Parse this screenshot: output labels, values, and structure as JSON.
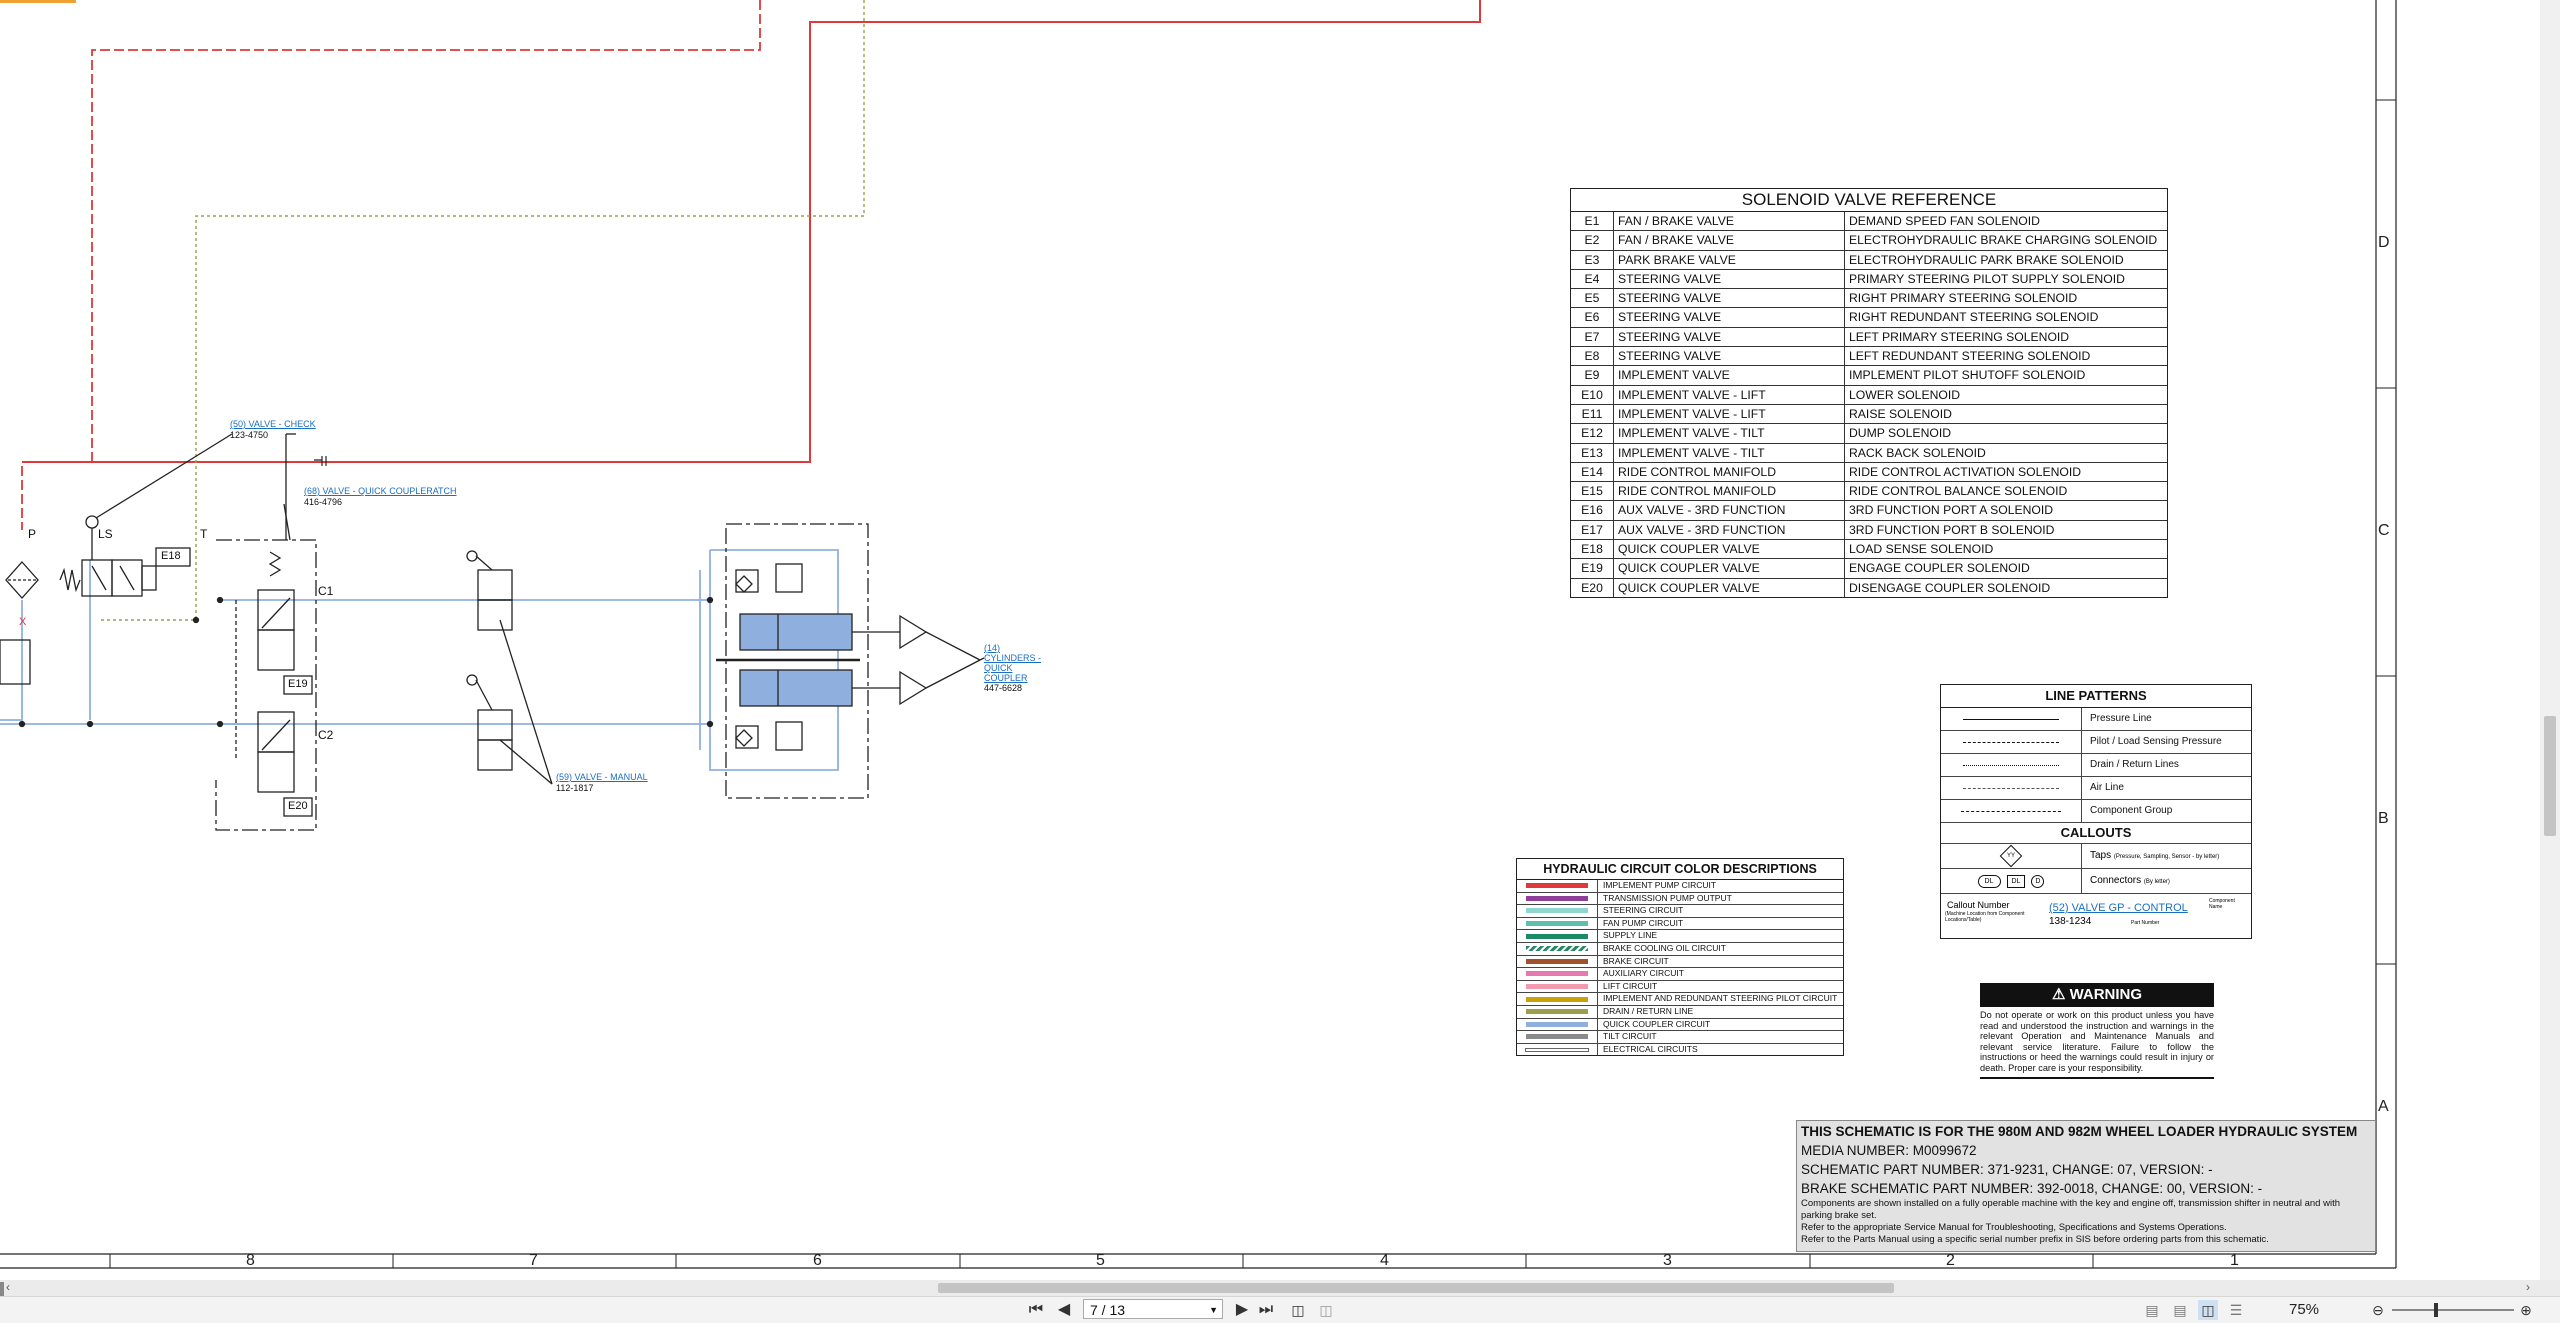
{
  "callouts": {
    "check_valve": {
      "name": "(50) VALVE - CHECK",
      "part": "123-4750"
    },
    "coupler_latch": {
      "name": "(68) VALVE - QUICK COUPLERATCH",
      "part": "416-4796"
    },
    "manual_valve": {
      "name": "(59) VALVE - MANUAL",
      "part": "112-1817"
    },
    "cylinders": {
      "name": "(14) CYLINDERS - QUICK COUPLER",
      "part": "447-6628"
    }
  },
  "schematic_labels": {
    "P": "P",
    "LS": "LS",
    "T": "T",
    "X": "X",
    "C1": "C1",
    "C2": "C2",
    "E18": "E18",
    "E19": "E19",
    "E20": "E20"
  },
  "solenoid": {
    "title": "SOLENOID VALVE REFERENCE",
    "rows": [
      [
        "E1",
        "FAN / BRAKE VALVE",
        "DEMAND SPEED FAN SOLENOID"
      ],
      [
        "E2",
        "FAN / BRAKE VALVE",
        "ELECTROHYDRAULIC BRAKE CHARGING SOLENOID"
      ],
      [
        "E3",
        "PARK BRAKE VALVE",
        "ELECTROHYDRAULIC PARK BRAKE SOLENOID"
      ],
      [
        "E4",
        "STEERING VALVE",
        "PRIMARY STEERING PILOT SUPPLY SOLENOID"
      ],
      [
        "E5",
        "STEERING VALVE",
        "RIGHT PRIMARY STEERING SOLENOID"
      ],
      [
        "E6",
        "STEERING VALVE",
        "RIGHT REDUNDANT STEERING SOLENOID"
      ],
      [
        "E7",
        "STEERING VALVE",
        "LEFT PRIMARY STEERING SOLENOID"
      ],
      [
        "E8",
        "STEERING VALVE",
        "LEFT REDUNDANT STEERING SOLENOID"
      ],
      [
        "E9",
        "IMPLEMENT VALVE",
        "IMPLEMENT PILOT SHUTOFF SOLENOID"
      ],
      [
        "E10",
        "IMPLEMENT VALVE - LIFT",
        "LOWER SOLENOID"
      ],
      [
        "E11",
        "IMPLEMENT VALVE - LIFT",
        "RAISE SOLENOID"
      ],
      [
        "E12",
        "IMPLEMENT VALVE - TILT",
        "DUMP SOLENOID"
      ],
      [
        "E13",
        "IMPLEMENT VALVE - TILT",
        "RACK BACK SOLENOID"
      ],
      [
        "E14",
        "RIDE CONTROL MANIFOLD",
        "RIDE CONTROL ACTIVATION SOLENOID"
      ],
      [
        "E15",
        "RIDE CONTROL MANIFOLD",
        "RIDE CONTROL BALANCE SOLENOID"
      ],
      [
        "E16",
        "AUX VALVE - 3RD FUNCTION",
        "3RD FUNCTION PORT A SOLENOID"
      ],
      [
        "E17",
        "AUX VALVE - 3RD FUNCTION",
        "3RD FUNCTION PORT B SOLENOID"
      ],
      [
        "E18",
        "QUICK COUPLER VALVE",
        "LOAD SENSE SOLENOID"
      ],
      [
        "E19",
        "QUICK COUPLER VALVE",
        "ENGAGE COUPLER SOLENOID"
      ],
      [
        "E20",
        "QUICK COUPLER VALVE",
        "DISENGAGE COUPLER SOLENOID"
      ]
    ]
  },
  "colors": {
    "title": "HYDRAULIC CIRCUIT COLOR DESCRIPTIONS",
    "rows": [
      {
        "label": "IMPLEMENT PUMP CIRCUIT",
        "color": "#e0393b"
      },
      {
        "label": "TRANSMISSION PUMP OUTPUT",
        "color": "#8e3f9a"
      },
      {
        "label": "STEERING CIRCUIT",
        "color": "#8fd6d0"
      },
      {
        "label": "FAN PUMP CIRCUIT",
        "color": "#5fbfae"
      },
      {
        "label": "SUPPLY LINE",
        "color": "#1d8a66"
      },
      {
        "label": "BRAKE COOLING OIL CIRCUIT",
        "color": "#2b8a66"
      },
      {
        "label": "BRAKE CIRCUIT",
        "color": "#a0522d"
      },
      {
        "label": "AUXILIARY CIRCUIT",
        "color": "#e67ab0"
      },
      {
        "label": "LIFT CIRCUIT",
        "color": "#f29ab0"
      },
      {
        "label": "IMPLEMENT AND REDUNDANT STEERING PILOT CIRCUIT",
        "color": "#c9a20a"
      },
      {
        "label": "DRAIN / RETURN LINE",
        "color": "#9aa04a"
      },
      {
        "label": "QUICK COUPLER CIRCUIT",
        "color": "#8fb0de"
      },
      {
        "label": "TILT CIRCUIT",
        "color": "#8a8a8a"
      },
      {
        "label": "ELECTRICAL CIRCUITS",
        "color": "#ffffff"
      }
    ]
  },
  "line_patterns": {
    "title": "LINE PATTERNS",
    "rows": [
      "Pressure Line",
      "Pilot / Load Sensing Pressure",
      "Drain / Return Lines",
      "Air Line",
      "Component Group"
    ],
    "callouts_title": "CALLOUTS",
    "taps": "Taps",
    "taps_note": "(Pressure, Sampling, Sensor - by letter)",
    "connectors": "Connectors",
    "connectors_note": "(By letter)",
    "tap_symbol": "YY",
    "conn_a": "DL",
    "conn_b": "DL",
    "conn_c": "D",
    "example_callout_number": "Callout Number",
    "example_callout_note": "(Machine Location from Component Locations/Table)",
    "example_link": "(52) VALVE GP - CONTROL",
    "example_part": "138-1234",
    "component_name": "Component Name",
    "part_number": "Part Number"
  },
  "warning": {
    "title": "WARNING",
    "body": "Do not operate or work on this product unless you have read and understood the instruction and warnings in the relevant Operation and Maintenance Manuals and relevant service literature. Failure to follow the instructions or heed the warnings could result in injury or death. Proper care is your responsibility."
  },
  "title_block": {
    "line1": "THIS SCHEMATIC IS FOR THE 980M AND 982M WHEEL LOADER HYDRAULIC SYSTEM",
    "line2": "MEDIA NUMBER: M0099672",
    "line3": "SCHEMATIC PART NUMBER: 371-9231, CHANGE: 07, VERSION: -",
    "line4": "BRAKE SCHEMATIC PART NUMBER: 392-0018, CHANGE: 00, VERSION: -",
    "line5": "Components are shown installed on a fully operable machine with the key and engine off, transmission shifter in neutral and with parking brake set.",
    "line6": "Refer to the appropriate Service Manual for Troubleshooting, Specifications and Systems Operations.",
    "line7": "Refer to the Parts Manual using a specific serial number prefix in SIS before ordering parts from this schematic."
  },
  "ruler": {
    "numbers": [
      "8",
      "7",
      "6",
      "5",
      "4",
      "3",
      "2",
      "1"
    ],
    "letters": [
      "D",
      "C",
      "B",
      "A"
    ]
  },
  "toolbar": {
    "page": "7 / 13",
    "zoom": "75%"
  }
}
